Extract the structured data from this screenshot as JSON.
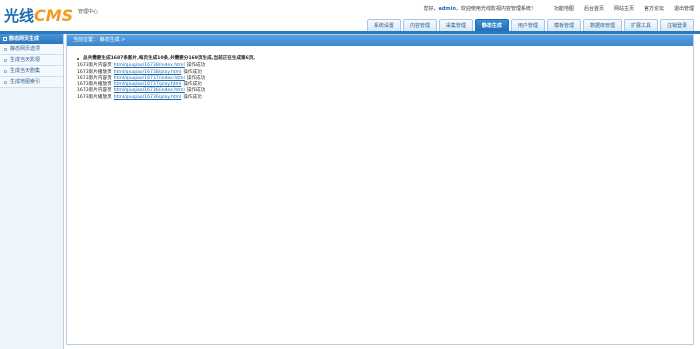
{
  "brand": {
    "logo_main": "光线",
    "logo_accent": "CMS",
    "subtitle": "管理中心"
  },
  "topline": {
    "welcome_prefix": "您好，",
    "user": "admin",
    "welcome_suffix": "，欢迎使用光线影视内容管理系统！",
    "links": [
      "功能地图",
      "后台首页",
      "网站主页",
      "官方论坛",
      "退出管理"
    ]
  },
  "tabs": [
    {
      "label": "系统设置",
      "active": false
    },
    {
      "label": "内容管理",
      "active": false
    },
    {
      "label": "采集管理",
      "active": false
    },
    {
      "label": "静态生成",
      "active": true
    },
    {
      "label": "用户管理",
      "active": false
    },
    {
      "label": "模板管理",
      "active": false
    },
    {
      "label": "数据库管理",
      "active": false
    },
    {
      "label": "扩展工具",
      "active": false
    },
    {
      "label": "注销登录",
      "active": false
    }
  ],
  "sidebar": {
    "title": "静态网页生成",
    "items": [
      "静态网页选项",
      "生成当天影视",
      "生成当天剧集",
      "生成地图索引"
    ]
  },
  "breadcrumb": "当前位置：  静态生成  >",
  "log": {
    "summary": "总共需要生成1687条影片,每页生成10条,共需要分169页生成,当前正在生成第6页,",
    "lines": [
      {
        "prefix": "1673影片内容页",
        "link": "html/qiuqiao/16738/index.html",
        "status": "操作成功"
      },
      {
        "prefix": "1673影片播放页",
        "link": "html/qiuqiao/16738/play.html",
        "status": "操作成功"
      },
      {
        "prefix": "1673影片内容页",
        "link": "html/qiuqiao/16737/index.html",
        "status": "操作成功"
      },
      {
        "prefix": "1673影片播放页",
        "link": "html/qiuqiao/16737/play.html",
        "status": "操作成功"
      },
      {
        "prefix": "1673影片内容页",
        "link": "html/qiuqiao/16736/index.html",
        "status": "操作成功"
      },
      {
        "prefix": "1673影片播放页",
        "link": "html/qiuqiao/16736/play.html",
        "status": "操作成功"
      }
    ]
  },
  "colors": {
    "brand_blue": "#1c6bb3",
    "accent_orange": "#f39a1e",
    "header_blue": "#2a7ac2"
  }
}
